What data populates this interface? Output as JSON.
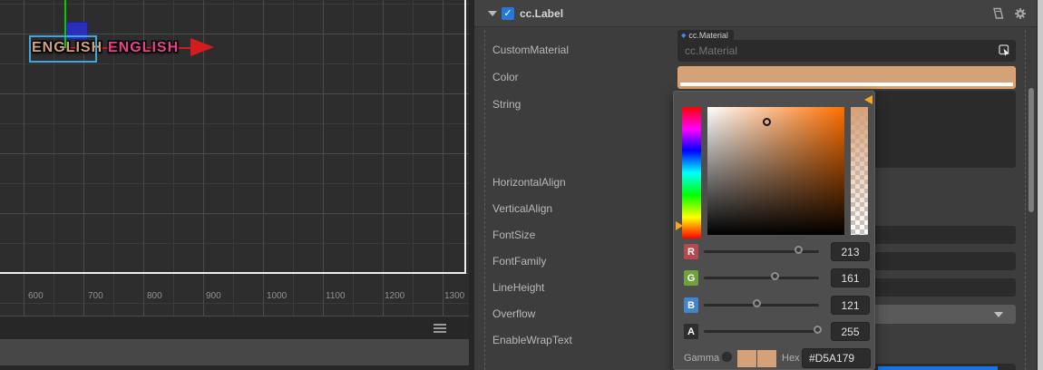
{
  "colors": {
    "accent": "#D5A179",
    "checkbox-blue": "#2878d8",
    "selection-blue": "#3fa6dd",
    "gizmo-red": "#d41c1c",
    "gizmo-green": "#00cc00",
    "gizmo-blue": "#2b2fd4",
    "label-tan": "#d5a179",
    "label-pink": "#ee3f8e",
    "focus-blue": "#1a73e8",
    "badge-r": "#b34a50",
    "badge-g": "#6fa23f",
    "badge-b": "#4086c8",
    "badge-a": "#2e2e2e"
  },
  "scene": {
    "labels": [
      {
        "text": "ENGLISH",
        "color": "#d5a179"
      },
      {
        "text": "ENGLISH",
        "color": "#ee3f8e"
      }
    ],
    "ruler_ticks": [
      "600",
      "700",
      "800",
      "900",
      "1000",
      "1100",
      "1200",
      "1300"
    ]
  },
  "inspector": {
    "header": {
      "title": "cc.Label",
      "enabled": true,
      "icons": [
        "help-icon",
        "settings-icon"
      ]
    },
    "rows": {
      "custom_material": {
        "label": "CustomMaterial",
        "tag": "cc.Material",
        "placeholder": "cc.Material"
      },
      "color": {
        "label": "Color",
        "value": "#D5A179"
      },
      "string": {
        "label": "String",
        "value": ""
      },
      "horizontal_align": {
        "label": "HorizontalAlign"
      },
      "vertical_align": {
        "label": "VerticalAlign"
      },
      "font_size": {
        "label": "FontSize"
      },
      "font_family": {
        "label": "FontFamily"
      },
      "line_height": {
        "label": "LineHeight"
      },
      "overflow": {
        "label": "Overflow"
      },
      "enable_wrap_text": {
        "label": "EnableWrapText"
      }
    }
  },
  "color_picker": {
    "channels": [
      {
        "label": "R",
        "value": 213
      },
      {
        "label": "G",
        "value": 161
      },
      {
        "label": "B",
        "value": 121
      },
      {
        "label": "A",
        "value": 255
      }
    ],
    "gamma_label": "Gamma",
    "hex_label": "Hex",
    "hex": "#D5A179"
  }
}
